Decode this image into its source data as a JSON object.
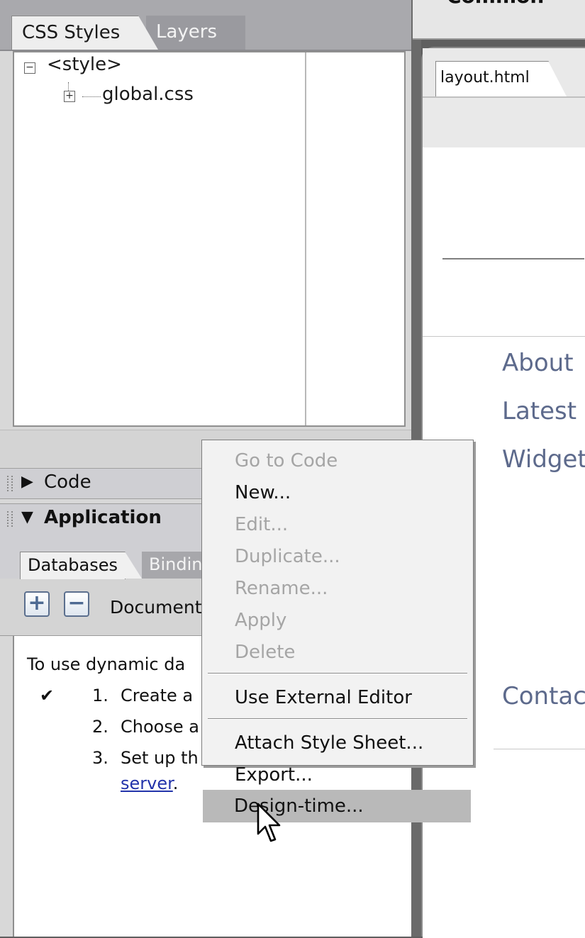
{
  "left_panel": {
    "css_tabs": [
      {
        "label": "CSS Styles"
      },
      {
        "label": "Layers"
      }
    ],
    "css_tree": {
      "root_label": "<style>",
      "child_label": "global.css"
    },
    "code_panel": {
      "title": "Code"
    },
    "application_panel": {
      "title": "Application",
      "tabs": [
        {
          "label": "Databases"
        },
        {
          "label": "Bindin"
        }
      ],
      "document_type_label": "Document",
      "instructions": {
        "intro": "To use dynamic da",
        "steps": [
          {
            "number": "1.",
            "text": "Create a",
            "done": true
          },
          {
            "number": "2.",
            "text": "Choose a",
            "done": false
          },
          {
            "number": "3.",
            "text": "Set up th",
            "done": false
          }
        ],
        "link_text": "server",
        "link_suffix": "."
      }
    }
  },
  "insert_bar": {
    "label": "Common"
  },
  "document": {
    "tab_label": "layout.html",
    "nav_links": [
      "About",
      "Latest",
      "Widget",
      "Contac"
    ]
  },
  "context_menu": {
    "items": [
      {
        "label": "Go to Code",
        "disabled": true
      },
      {
        "label": "New...",
        "disabled": false
      },
      {
        "label": "Edit...",
        "disabled": true
      },
      {
        "label": "Duplicate...",
        "disabled": true
      },
      {
        "label": "Rename...",
        "disabled": true
      },
      {
        "label": "Apply",
        "disabled": true
      },
      {
        "label": "Delete",
        "disabled": true
      },
      {
        "label": "Use External Editor",
        "disabled": false
      },
      {
        "label": "Attach Style Sheet...",
        "disabled": false
      },
      {
        "label": "Export...",
        "disabled": false
      },
      {
        "label": "Design-time...",
        "disabled": false,
        "selected": true
      }
    ]
  },
  "icons": {
    "tree_collapse": "minus-box-icon",
    "tree_expand": "plus-box-icon",
    "add": "plus-icon",
    "remove": "minus-icon",
    "collapse_arrow": "triangle-right-icon",
    "expand_arrow": "triangle-down-icon",
    "check": "checkmark-icon",
    "cursor": "mouse-pointer-icon"
  },
  "colors": {
    "nav_link": "#5d6a8c",
    "link": "#2233aa",
    "menu_selected": "#b9b9b9",
    "disabled_text": "#a5a5a5"
  }
}
